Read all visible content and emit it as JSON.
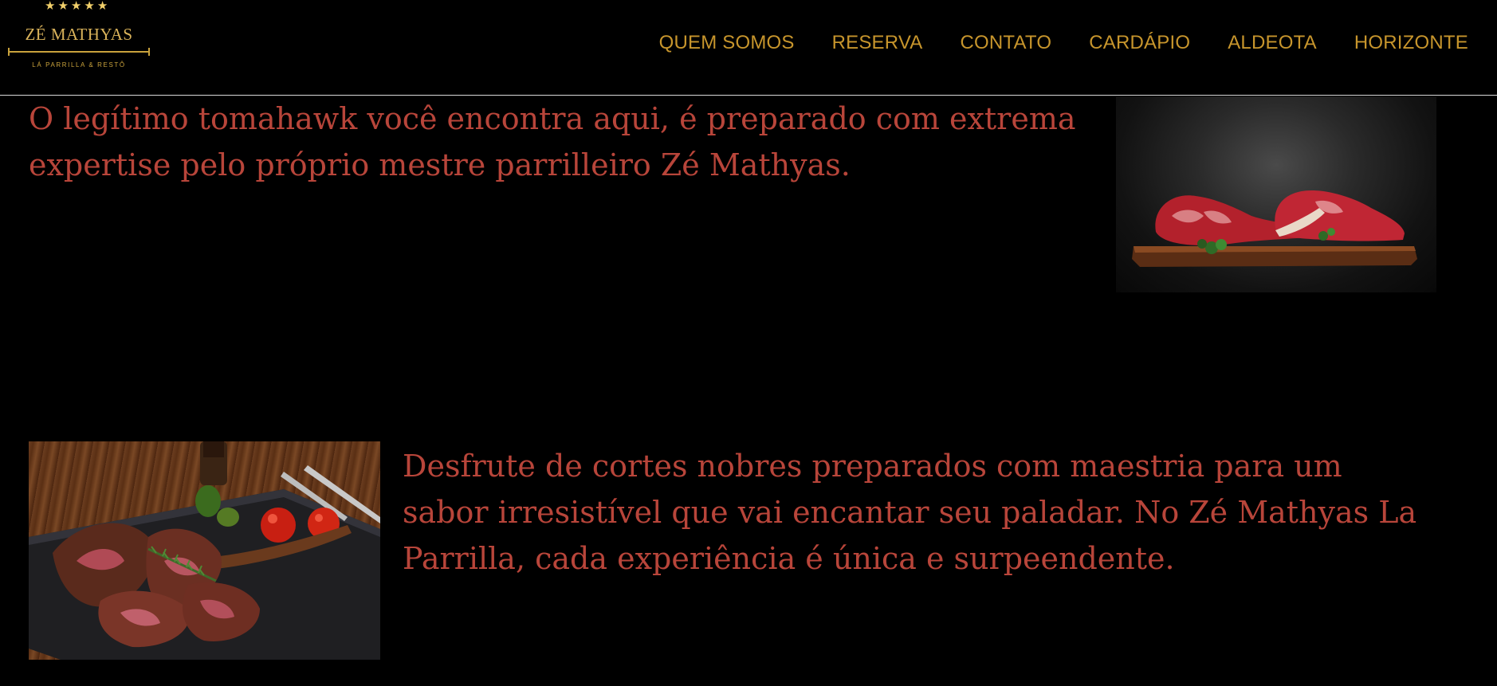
{
  "logo": {
    "stars": [
      "★",
      "★",
      "★",
      "★",
      "★"
    ],
    "name": "ZÉ MATHYAS",
    "tagline": "LÁ PARRILLA & RESTÔ"
  },
  "nav": {
    "items": [
      "QUEM SOMOS",
      "RESERVA",
      "CONTATO",
      "CARDÁPIO",
      "ALDEOTA",
      "HORIZONTE"
    ]
  },
  "section1": {
    "text": "O legítimo tomahawk você encontra aqui, é preparado com extrema expertise pelo próprio mestre parrilleiro Zé Mathyas."
  },
  "section2": {
    "text": "Desfrute de cortes nobres preparados com maestria para um sabor irresistível que vai encantar seu paladar. No Zé Mathyas La Parrilla, cada experiência é única e surpeendente."
  },
  "colors": {
    "background": "#000000",
    "gold": "#c7952c",
    "text_red": "#b8453a"
  },
  "icons": {
    "star": "star-icon"
  }
}
